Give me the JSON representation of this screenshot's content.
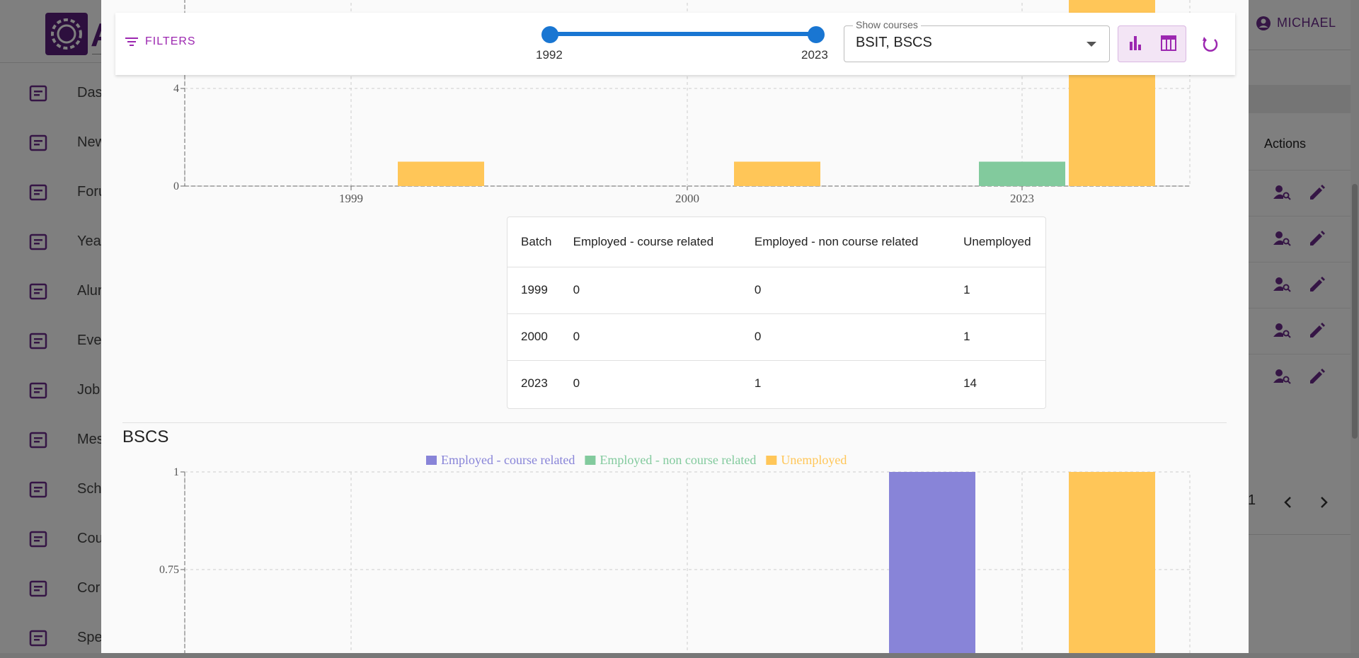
{
  "background": {
    "sidebar": {
      "items": [
        {
          "label": "Das",
          "icon": "dashboard-icon"
        },
        {
          "label": "New",
          "icon": "newspaper-icon"
        },
        {
          "label": "Foru",
          "icon": "forum-icon"
        },
        {
          "label": "Yea",
          "icon": "book-icon"
        },
        {
          "label": "Alur",
          "icon": "school-icon"
        },
        {
          "label": "Eve",
          "icon": "calendar-icon"
        },
        {
          "label": "Job",
          "icon": "briefcase-icon"
        },
        {
          "label": "Mes",
          "icon": "message-icon"
        },
        {
          "label": "Sch",
          "icon": "institution-icon"
        },
        {
          "label": "Cou",
          "icon": "library-icon"
        },
        {
          "label": "Cor",
          "icon": "building-icon"
        },
        {
          "label": "Spe",
          "icon": "speaker-icon"
        }
      ]
    },
    "header": {
      "user_name": "MICHAEL"
    },
    "table": {
      "actions_header": "Actions",
      "row_count": 5
    },
    "pagination": {
      "page": "1"
    }
  },
  "filters": {
    "button_label": "FILTERS",
    "year_range": {
      "min": 1992,
      "max": 2023,
      "min_label": "1992",
      "max_label": "2023",
      "low": 1992,
      "high": 2023
    },
    "courses": {
      "label": "Show courses",
      "value": "BSIT, BSCS"
    },
    "view_toggle": [
      "bar-chart-icon",
      "table-icon"
    ],
    "refresh_icon": "refresh-icon"
  },
  "colors": {
    "course_related": "#8884d8",
    "non_course_related": "#82ca9d",
    "unemployed": "#ffc658",
    "accent": "#9c27b0",
    "slider": "#1976d2"
  },
  "bsit_table": {
    "headers": [
      "Batch",
      "Employed - course related",
      "Employed - non course related",
      "Unemployed"
    ],
    "rows": [
      [
        "1999",
        "0",
        "0",
        "1"
      ],
      [
        "2000",
        "0",
        "0",
        "1"
      ],
      [
        "2023",
        "0",
        "1",
        "14"
      ]
    ]
  },
  "bscs": {
    "title": "BSCS"
  },
  "chart_data": [
    {
      "type": "bar",
      "categories": [
        "1999",
        "2000",
        "2023"
      ],
      "series": [
        {
          "name": "Employed - course related",
          "values": [
            0,
            0,
            0
          ]
        },
        {
          "name": "Employed - non course related",
          "values": [
            0,
            0,
            1
          ]
        },
        {
          "name": "Unemployed",
          "values": [
            1,
            1,
            14
          ]
        }
      ],
      "yticks": [
        0,
        4
      ],
      "grid": true
    },
    {
      "type": "bar",
      "title": "BSCS",
      "categories": [
        "1999",
        "2000",
        "2023"
      ],
      "series": [
        {
          "name": "Employed - course related",
          "values": [
            0,
            0,
            1
          ]
        },
        {
          "name": "Employed - non course related",
          "values": [
            0,
            0,
            0
          ]
        },
        {
          "name": "Unemployed",
          "values": [
            0,
            0,
            1
          ]
        }
      ],
      "yticks": [
        0.75,
        1
      ],
      "legend": "top-center",
      "grid": true
    }
  ]
}
